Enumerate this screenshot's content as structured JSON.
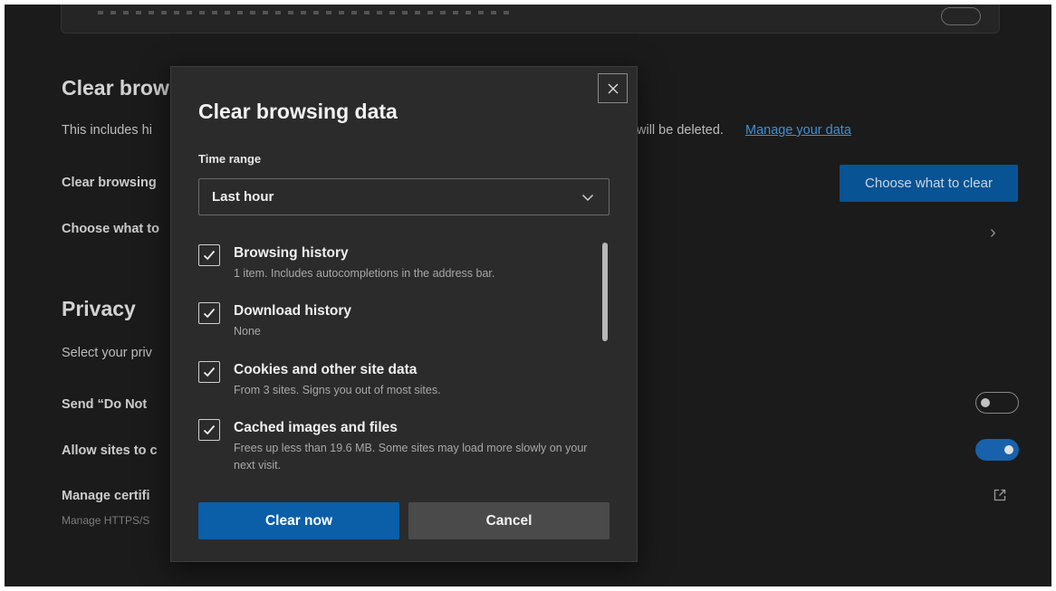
{
  "settings": {
    "clear_section": {
      "heading": "Clear brow",
      "description_left": "This includes hi",
      "description_right": "will be deleted.",
      "manage_link": "Manage your data",
      "row1_label": "Clear browsing",
      "choose_button": "Choose what to clear",
      "row2_label": "Choose what to"
    },
    "privacy_section": {
      "heading": "Privacy",
      "description": "Select your priv",
      "dnt_label": "Send “Do Not",
      "dnt_toggle": "off",
      "allow_label": "Allow sites to c",
      "allow_toggle": "on",
      "certs_label": "Manage certifi",
      "certs_sub": "Manage HTTPS/S"
    }
  },
  "dialog": {
    "title": "Clear browsing data",
    "time_range_label": "Time range",
    "time_range_value": "Last hour",
    "items": [
      {
        "title": "Browsing history",
        "desc": "1 item. Includes autocompletions in the address bar.",
        "checked": true
      },
      {
        "title": "Download history",
        "desc": "None",
        "checked": true
      },
      {
        "title": "Cookies and other site data",
        "desc": "From 3 sites. Signs you out of most sites.",
        "checked": true
      },
      {
        "title": "Cached images and files",
        "desc": "Frees up less than 19.6 MB. Some sites may load more slowly on your next visit.",
        "checked": true
      }
    ],
    "clear_button": "Clear now",
    "cancel_button": "Cancel"
  },
  "colors": {
    "accent": "#0a5fa8",
    "link": "#4fa3e8",
    "background": "#1f1f1f",
    "dialog": "#2b2b2b"
  },
  "icons": [
    "close-icon",
    "chevron-down-icon",
    "checkmark-icon",
    "chevron-right-icon",
    "external-link-icon"
  ]
}
